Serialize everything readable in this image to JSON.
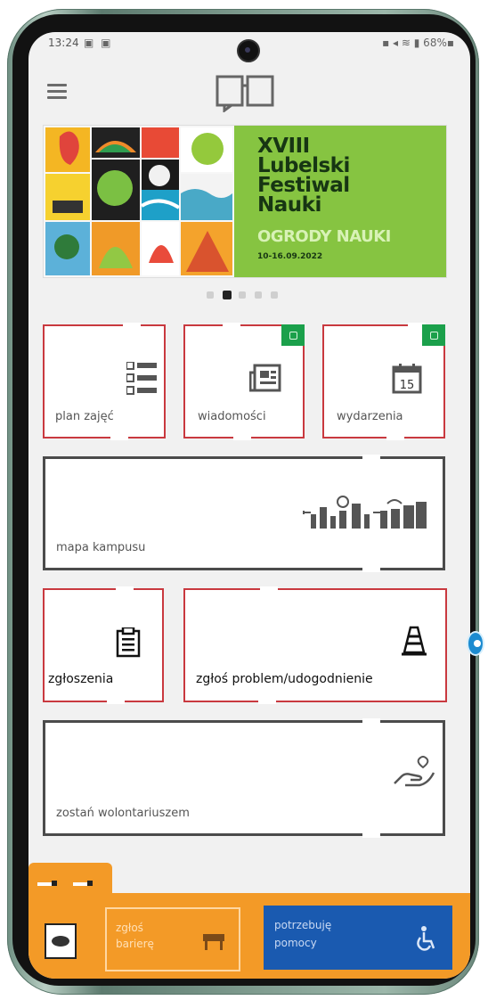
{
  "status_bar": {
    "time": "13:24",
    "left_icons": "▣ ▣",
    "right": "▪ ◂ ≋ ▮ 68%▪"
  },
  "header": {
    "menu_icon": "menu-icon",
    "logo_icon": "book-icon"
  },
  "banner": {
    "title_line1": "XVIII",
    "title_line2": "Lubelski",
    "title_line3": "Festiwal",
    "title_line4": "Nauki",
    "subtitle": "OGRODY NAUKI",
    "date": "10-16.09.2022",
    "colors": {
      "green": "#86c441",
      "dark": "#173613"
    },
    "pager": {
      "count": 5,
      "active_index": 1
    }
  },
  "tiles": {
    "plan": {
      "label": "plan zajęć",
      "icon": "list-icon"
    },
    "news": {
      "label": "wiadomości",
      "icon": "newspaper-icon",
      "badge_icon": "lock-icon"
    },
    "events": {
      "label": "wydarzenia",
      "icon": "calendar-icon",
      "calendar_day": "15",
      "badge_icon": "lock-icon"
    },
    "map": {
      "label": "mapa kampusu",
      "icon": "city-icon"
    },
    "reports": {
      "label": "zgłoszenia",
      "icon": "clipboard-icon"
    },
    "problem": {
      "label": "zgłoś problem/udogodnienie",
      "icon": "traffic-cone-icon"
    },
    "volunteer": {
      "label": "zostań wolontariuszem",
      "icon": "heart-hand-icon"
    }
  },
  "bottom_bar": {
    "barrier_label_line1": "zgłoś",
    "barrier_label_line2": "barierę",
    "barrier_icon": "barrier-icon",
    "help_label_line1": "potrzebuję",
    "help_label_line2": "pomocy",
    "help_icon": "wheelchair-icon",
    "eye_icon": "eye-icon",
    "colors": {
      "orange": "#f39a27",
      "blue": "#1a5ab0",
      "red_border": "#c9393f",
      "green_badge": "#1ba04b"
    }
  }
}
